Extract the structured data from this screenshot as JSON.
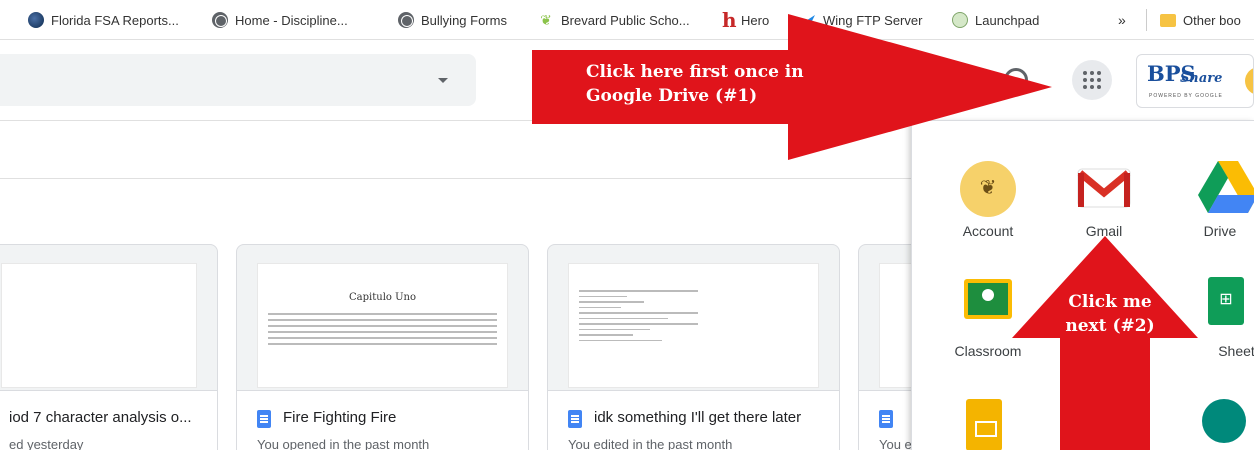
{
  "bookmarks": [
    {
      "label": "Florida FSA Reports...",
      "icon": "globe-dark-icon"
    },
    {
      "label": "Home - Discipline...",
      "icon": "globe-icon"
    },
    {
      "label": "Bullying Forms",
      "icon": "globe-icon"
    },
    {
      "label": "Brevard Public Scho...",
      "icon": "bps-leaf-icon"
    },
    {
      "label": "Hero",
      "icon": "hero-h-icon"
    },
    {
      "label": "Wing FTP Server",
      "icon": "wing-icon"
    },
    {
      "label": "Launchpad",
      "icon": "launchpad-icon"
    }
  ],
  "overflow_label": "»",
  "other_bookmarks": "Other boo",
  "header": {
    "logo_bps": "BPS",
    "logo_share": "Share",
    "logo_powered": "POWERED BY GOOGLE"
  },
  "cards": [
    {
      "title": "iod 7 character analysis o...",
      "subtitle": "ed yesterday"
    },
    {
      "title": "Fire Fighting Fire",
      "subtitle": "You opened in the past month",
      "doc_heading": "Capitulo Uno"
    },
    {
      "title": "idk something I'll get there later",
      "subtitle": "You edited in the past month"
    },
    {
      "title": "",
      "subtitle": "You e"
    }
  ],
  "apps": [
    {
      "label": "Account",
      "icon": "account-icon"
    },
    {
      "label": "Gmail",
      "icon": "gmail-icon"
    },
    {
      "label": "Drive",
      "icon": "drive-icon"
    },
    {
      "label": "Classroom",
      "icon": "classroom-icon"
    },
    {
      "label": "",
      "icon": "classroom-arrow"
    },
    {
      "label": "Sheets",
      "icon": "sheets-icon"
    },
    {
      "label": "",
      "icon": "slides-icon"
    },
    {
      "label": "",
      "icon": "meet-icon"
    }
  ],
  "annotations": {
    "arrow1": "Click here first once in Google Drive (#1)",
    "arrow1_line1": "Click here first once in",
    "arrow1_line2": "Google Drive (#1)",
    "arrow2_line1": "Click me",
    "arrow2_line2": "next (#2)"
  },
  "colors": {
    "arrow_red": "#e0141b",
    "google_blue": "#4285f4"
  }
}
